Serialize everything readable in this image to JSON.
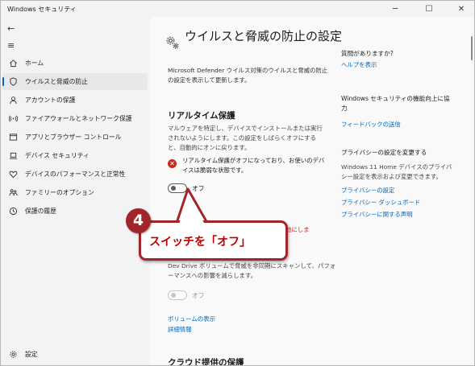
{
  "window": {
    "title": "Windows セキュリティ",
    "minimize_icon": "─",
    "maximize_icon": "☐",
    "close_icon": "✕"
  },
  "nav": {
    "back_icon": "←",
    "menu_icon": "≡",
    "items": [
      {
        "label": "ホーム",
        "icon": "home-icon"
      },
      {
        "label": "ウイルスと脅威の防止",
        "icon": "shield-icon",
        "active": true
      },
      {
        "label": "アカウントの保護",
        "icon": "person-icon"
      },
      {
        "label": "ファイアウォールとネットワーク保護",
        "icon": "wifi-icon"
      },
      {
        "label": "アプリとブラウザー コントロール",
        "icon": "app-window-icon"
      },
      {
        "label": "デバイス セキュリティ",
        "icon": "laptop-icon"
      },
      {
        "label": "デバイスのパフォーマンスと正常性",
        "icon": "heart-icon"
      },
      {
        "label": "ファミリーのオプション",
        "icon": "family-icon"
      },
      {
        "label": "保護の履歴",
        "icon": "history-icon"
      }
    ],
    "settings_label": "設定"
  },
  "main": {
    "title": "ウイルスと脅威の防止の設定",
    "description": "Microsoft Defender ウイルス対策のウイルスと脅威の防止の設定を表示して更新します。",
    "realtime": {
      "heading": "リアルタイム保護",
      "description": "マルウェアを特定し、デバイスでインストールまたは実行されないようにします。この設定をしばらくオフにすると、自動的にオンに戻ります。",
      "warning": "リアルタイム保護がオフになっており、お使いのデバイスは脆弱な状態です。",
      "toggle_label": "オフ",
      "toggle_on": false,
      "partial_link": "ム保護を有効にしま"
    },
    "dev_drive": {
      "description": "Dev Drive ボリュームで脅威を非同期にスキャンして、パフォーマンスへの影響を減らします。",
      "toggle_label": "オフ",
      "toggle_on": false,
      "link_volumes": "ボリュームの表示",
      "link_details": "詳細情報"
    },
    "cloud_heading": "クラウド提供の保護"
  },
  "sidebar": {
    "help": {
      "heading": "質問がありますか?",
      "link": "ヘルプを表示"
    },
    "feedback": {
      "heading": "Windows セキュリティの機能向上に協力",
      "link": "フィードバックの送信"
    },
    "privacy": {
      "heading": "プライバシーの設定を変更する",
      "text": "Windows 11 Home デバイスのプライバシー設定を表示および変更できます。",
      "links": [
        "プライバシーの設定",
        "プライバシー ダッシュボード",
        "プライバシーに関する声明"
      ]
    }
  },
  "callout": {
    "number": "4",
    "text": "スイッチを「オフ」"
  },
  "colors": {
    "accent": "#0067c0",
    "warning": "#c42b1c",
    "callout": "#a1262c"
  }
}
